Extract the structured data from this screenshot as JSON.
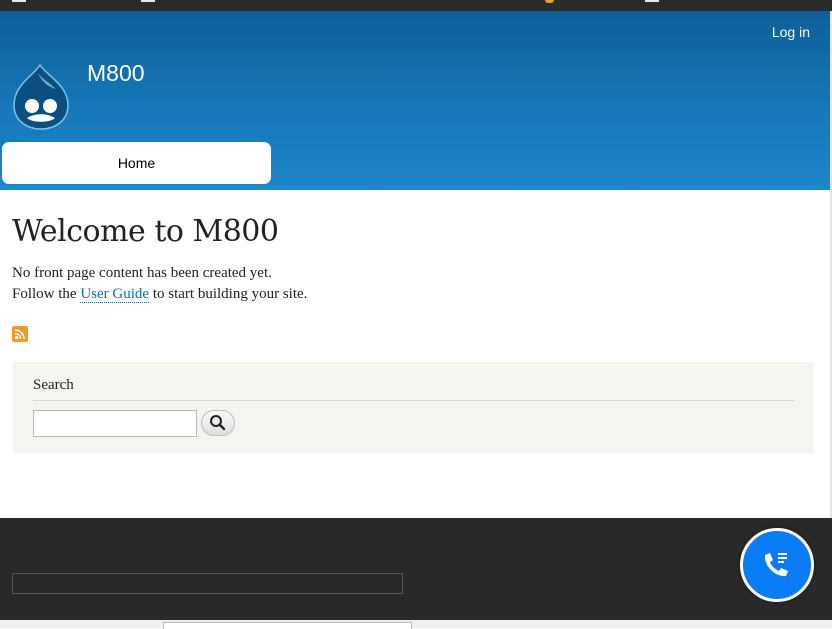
{
  "header": {
    "login_label": "Log in",
    "site_name": "M800",
    "logo_icon": "drupal-drop-logo",
    "bg_color": "#1678b8"
  },
  "nav": {
    "items": [
      {
        "label": "Home"
      }
    ]
  },
  "main": {
    "title": "Welcome to M800",
    "line1": "No front page content has been created yet.",
    "line2_before": "Follow the ",
    "line2_link": "User Guide",
    "line2_after": " to start building your site.",
    "feed_icon": "rss-icon"
  },
  "search": {
    "title": "Search",
    "input_value": "",
    "button_icon": "search-icon"
  },
  "footer": {
    "bg_color": "#292929",
    "call_icon": "phone-call-icon",
    "call_color": "#0a7cf6"
  }
}
